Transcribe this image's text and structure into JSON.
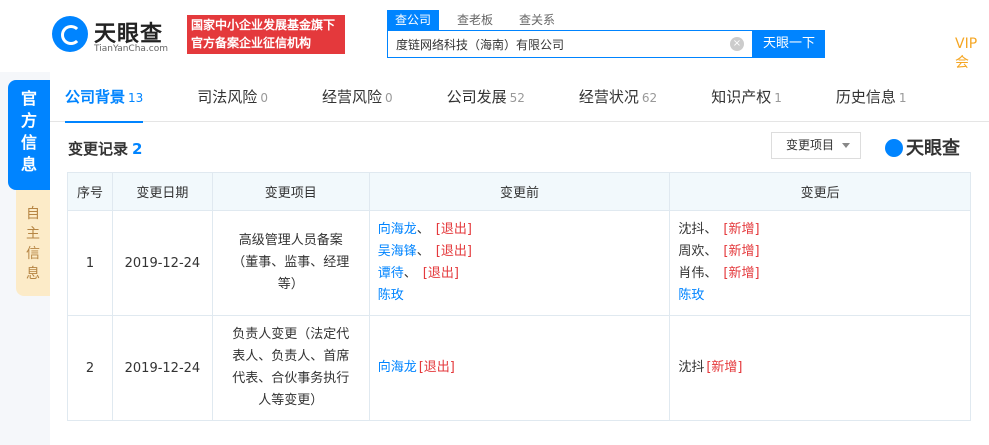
{
  "header": {
    "logo_text": "天眼查",
    "logo_sub": "TianYanCha.com",
    "badge_line1": "国家中小企业发展基金旗下",
    "badge_line2": "官方备案企业征信机构",
    "search_tabs": [
      "查公司",
      "查老板",
      "查关系"
    ],
    "search_value": "度链网络科技（海南）有限公司",
    "search_button": "天眼一下",
    "vip_label": "VIP会"
  },
  "sidebar": {
    "official": "官方信息",
    "self": "自主信息"
  },
  "tabs": [
    {
      "label": "公司背景",
      "count": "13"
    },
    {
      "label": "司法风险",
      "count": "0"
    },
    {
      "label": "经营风险",
      "count": "0"
    },
    {
      "label": "公司发展",
      "count": "52"
    },
    {
      "label": "经营状况",
      "count": "62"
    },
    {
      "label": "知识产权",
      "count": "1"
    },
    {
      "label": "历史信息",
      "count": "1"
    }
  ],
  "section": {
    "title": "变更记录",
    "count": "2",
    "filter_label": "变更项目",
    "brand": "天眼查"
  },
  "table": {
    "headers": [
      "序号",
      "变更日期",
      "变更项目",
      "变更前",
      "变更后"
    ],
    "rows": [
      {
        "index": "1",
        "date": "2019-12-24",
        "item": "高级管理人员备案（董事、监事、经理等）",
        "before": [
          {
            "name": "向海龙",
            "sep": "、",
            "status": "[退出]"
          },
          {
            "name": "吴海锋",
            "sep": "、",
            "status": "[退出]"
          },
          {
            "name": "谭待",
            "sep": "、",
            "status": "[退出]"
          },
          {
            "name": "陈玫",
            "sep": "",
            "status": ""
          }
        ],
        "after": [
          {
            "name": "沈抖",
            "sep": "、",
            "status": "[新增]"
          },
          {
            "name": "周欢",
            "sep": "、",
            "status": "[新增]"
          },
          {
            "name": "肖伟",
            "sep": "、",
            "status": "[新增]"
          },
          {
            "name": "陈玫",
            "sep": "",
            "status": ""
          }
        ]
      },
      {
        "index": "2",
        "date": "2019-12-24",
        "item": "负责人变更（法定代表人、负责人、首席代表、合伙事务执行人等变更）",
        "before": [
          {
            "name": "向海龙",
            "sep": "",
            "status": "[退出]"
          }
        ],
        "after": [
          {
            "name": "沈抖",
            "sep": "",
            "status": "[新增]"
          }
        ]
      }
    ]
  }
}
